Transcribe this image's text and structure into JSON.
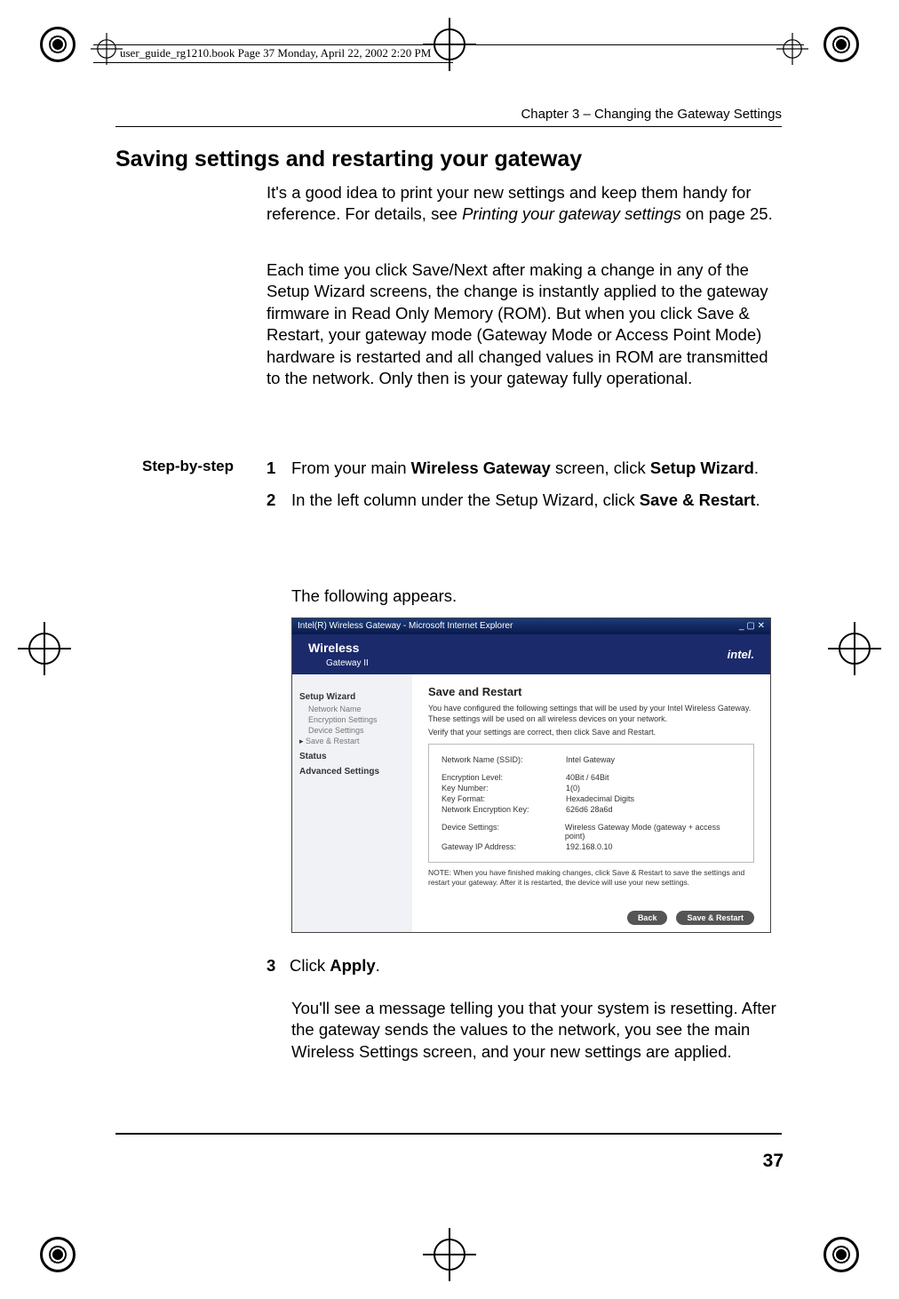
{
  "crop_marks": {
    "top_rule_width": 880
  },
  "filepath": "user_guide_rg1210.book  Page 37  Monday, April 22, 2002  2:20 PM",
  "chapter": "Chapter 3  –  Changing the Gateway Settings",
  "heading": "Saving settings and restarting your gateway",
  "intro1_a": "It's a good idea to print your new settings and keep them handy for reference. For details, see ",
  "intro1_ital": "Printing your gateway settings",
  "intro1_b": " on page 25.",
  "intro2": "Each time you click Save/Next after making a change in any of the Setup Wizard screens, the change is instantly applied to the gateway firmware in Read Only Memory (ROM). But when you click Save & Restart, your gateway mode (Gateway Mode or Access Point Mode) hardware is restarted and all changed values in ROM are transmitted to the network. Only then is your gateway fully operational.",
  "step_label": "Step-by-step",
  "steps": {
    "s1_num": "1",
    "s1_a": "From your main ",
    "s1_b1": "Wireless Gateway",
    "s1_c": " screen, click ",
    "s1_b2": "Setup Wizard",
    "s1_d": ".",
    "s2_num": "2",
    "s2_a": "In the left column under the Setup Wizard, click ",
    "s2_b1": "Save & Restart",
    "s2_c": ".",
    "following": "The following appears.",
    "s3_num": "3",
    "s3_a": "Click ",
    "s3_b1": "Apply",
    "s3_c": "."
  },
  "after": "You'll see a message telling you that your system is resetting. After the gateway sends the values to the network, you see the main Wireless Settings screen, and your new settings are applied.",
  "page_number": "37",
  "screenshot": {
    "titlebar_left": "Intel(R) Wireless Gateway - Microsoft Internet Explorer",
    "titlebar_right": "_ ▢ ✕",
    "brand_left": "Wireless",
    "brand_left2": "Gateway II",
    "brand_right": "intel.",
    "sidebar": {
      "setup_wizard": "Setup Wizard",
      "network_name": "Network Name",
      "encryption_settings": "Encryption Settings",
      "device_settings": "Device Settings",
      "save_restart": "Save & Restart",
      "status": "Status",
      "advanced_settings": "Advanced Settings"
    },
    "main": {
      "title": "Save and Restart",
      "desc1": "You have configured the following settings that will be used by your Intel Wireless Gateway. These settings will be used on all wireless devices on your network.",
      "desc2": "Verify that your settings are correct, then click Save and Restart.",
      "rows": {
        "ssid_k": "Network Name (SSID):",
        "ssid_v": "Intel Gateway",
        "enc_k": "Encryption Level:",
        "enc_v": "40Bit / 64Bit",
        "keynum_k": "Key Number:",
        "keynum_v": "1(0)",
        "keyfmt_k": "Key Format:",
        "keyfmt_v": "Hexadecimal Digits",
        "netkey_k": "Network Encryption Key:",
        "netkey_v": "626d6 28a6d",
        "dev_k": "Device Settings:",
        "dev_v": "Wireless Gateway Mode (gateway + access point)",
        "ip_k": "Gateway IP Address:",
        "ip_v": "192.168.0.10"
      },
      "note": "NOTE: When you have finished making changes, click Save & Restart to save the settings and restart your gateway. After it is restarted, the device will use your new settings.",
      "btn_back": "Back",
      "btn_save": "Save & Restart"
    }
  }
}
